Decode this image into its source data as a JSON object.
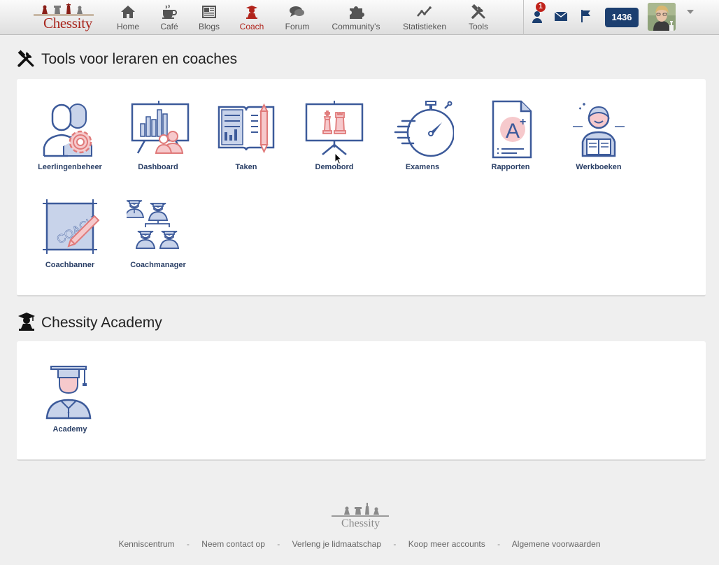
{
  "brand": {
    "name": "Chessity"
  },
  "nav": [
    {
      "label": "Home",
      "icon": "home-icon"
    },
    {
      "label": "Café",
      "icon": "coffee-cup-icon"
    },
    {
      "label": "Blogs",
      "icon": "newspaper-icon"
    },
    {
      "label": "Coach",
      "icon": "coach-pawn-icon",
      "active": true
    },
    {
      "label": "Forum",
      "icon": "speech-bubbles-icon"
    },
    {
      "label": "Community's",
      "icon": "puzzle-icon"
    },
    {
      "label": "Statistieken",
      "icon": "line-chart-icon"
    },
    {
      "label": "Tools",
      "icon": "wrench-hammer-icon"
    }
  ],
  "topbar": {
    "notification_count": "1",
    "rating": "1436"
  },
  "sections": {
    "tools": {
      "title": "Tools voor leraren en coaches",
      "icon": "wrench-hammer-icon",
      "items": [
        {
          "label": "Leerlingenbeheer",
          "icon": "students-gear-icon"
        },
        {
          "label": "Dashboard",
          "icon": "dashboard-presentation-icon"
        },
        {
          "label": "Taken",
          "icon": "book-pencil-icon"
        },
        {
          "label": "Demobord",
          "icon": "demo-board-icon"
        },
        {
          "label": "Examens",
          "icon": "stopwatch-icon"
        },
        {
          "label": "Rapporten",
          "icon": "report-grade-icon"
        },
        {
          "label": "Werkboeken",
          "icon": "reading-student-icon"
        },
        {
          "label": "Coachbanner",
          "icon": "coach-banner-icon"
        },
        {
          "label": "Coachmanager",
          "icon": "graduates-hierarchy-icon"
        }
      ]
    },
    "academy": {
      "title": "Chessity Academy",
      "icon": "graduate-pawn-icon",
      "items": [
        {
          "label": "Academy",
          "icon": "graduate-student-icon"
        }
      ]
    }
  },
  "footer": {
    "links": [
      "Kenniscentrum",
      "Neem contact op",
      "Verleng je lidmaatschap",
      "Koop meer accounts",
      "Algemene voorwaarden"
    ],
    "separator": "-"
  },
  "colors": {
    "brand_red": "#a8261d",
    "icon_blue": "#3c5a9a",
    "icon_pink": "#f6c9cc",
    "label_blue": "#2a3f66",
    "rating_bg": "#1c3f70"
  }
}
